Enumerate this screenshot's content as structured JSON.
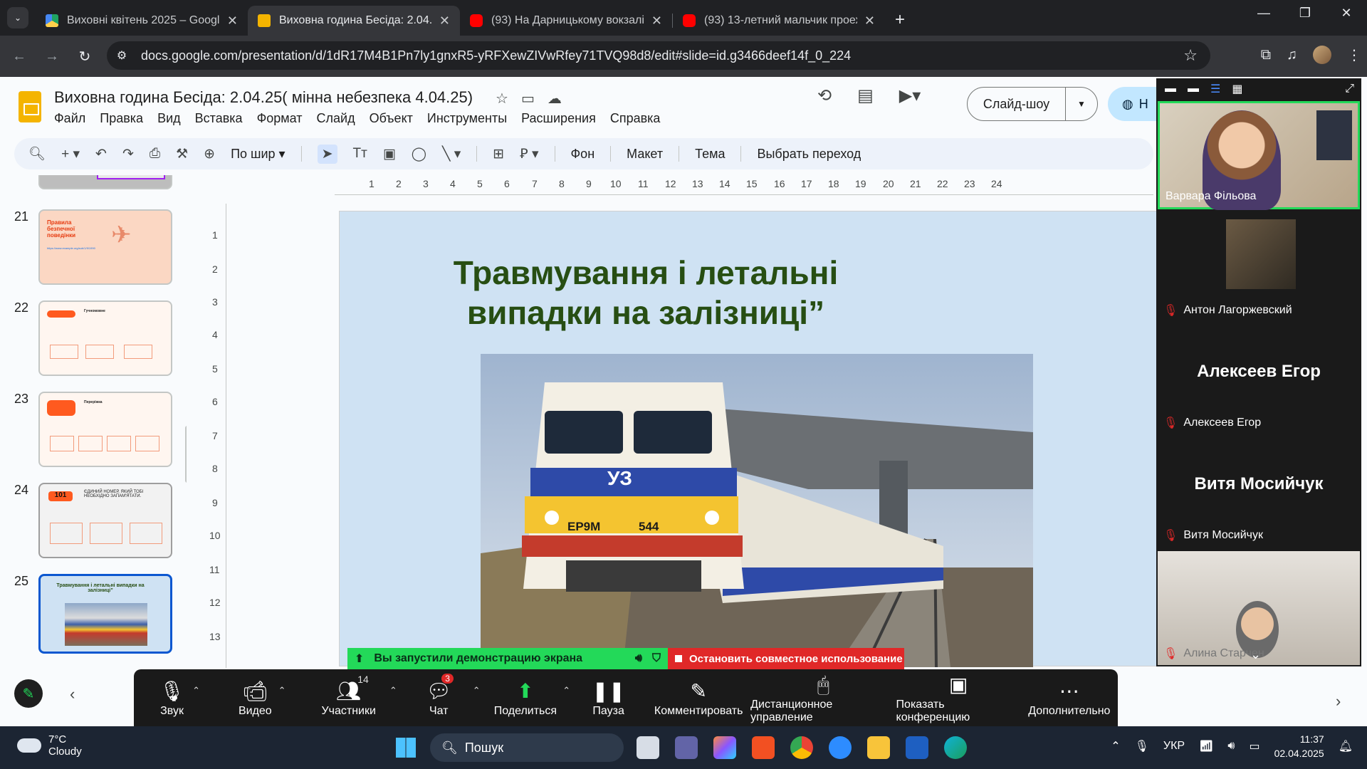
{
  "browser": {
    "tabs": [
      {
        "title": "Виховні квітень 2025 – Google",
        "favicon": "google-drive-icon",
        "active": false
      },
      {
        "title": "Виховна година Бесіда: 2.04.25",
        "favicon": "google-slides-icon",
        "active": true
      },
      {
        "title": "(93) На Дарницькому вокзалі",
        "favicon": "youtube-icon",
        "active": false
      },
      {
        "title": "(93) 13-летний мальчик проех",
        "favicon": "youtube-icon",
        "active": false
      }
    ],
    "url": "docs.google.com/presentation/d/1dR17M4B1Pn7ly1gnxR5-yRFXewZIVwRfey71TVQ98d8/edit#slide=id.g3466deef14f_0_224"
  },
  "slides": {
    "doc_title": "Виховна година Бесіда: 2.04.25( мінна небезпека 4.04.25)",
    "menu": [
      "Файл",
      "Правка",
      "Вид",
      "Вставка",
      "Формат",
      "Слайд",
      "Объект",
      "Инструменты",
      "Расширения",
      "Справка"
    ],
    "slideshow_label": "Слайд-шоу",
    "share_label": "Н",
    "toolbar": {
      "zoom_label": "По шир",
      "background": "Фон",
      "layout": "Макет",
      "theme": "Тема",
      "transition": "Выбрать переход"
    },
    "filmstrip": [
      {
        "num": "21",
        "title": "Правила безпечної поведінки",
        "link": "https://www.example.org/sub/1/9/1990"
      },
      {
        "num": "22",
        "title": "Гучномовне"
      },
      {
        "num": "23",
        "title": "Переріжка"
      },
      {
        "num": "24",
        "title": "ЄДИНИЙ НОМЕР, ЯКИЙ ТОБІ НЕОБХІДНО ЗАПАМ'ЯТАТИ.",
        "badge": "101"
      },
      {
        "num": "25",
        "title": "Травмування і летальні випадки на залізниці”"
      }
    ],
    "ruler_h": [
      "1",
      "2",
      "3",
      "4",
      "5",
      "6",
      "7",
      "8",
      "9",
      "10",
      "11",
      "12",
      "13",
      "14",
      "15",
      "16",
      "17",
      "18",
      "19",
      "20",
      "21",
      "22",
      "23",
      "24"
    ],
    "ruler_v": [
      "1",
      "2",
      "3",
      "4",
      "5",
      "6",
      "7",
      "8",
      "9",
      "10",
      "11",
      "12",
      "13"
    ],
    "current_slide": {
      "title": "Травмування і летальні випадки на залізниці”",
      "train_logo": "УЗ",
      "train_model": "ЕР9М",
      "train_number": "544"
    }
  },
  "zoom": {
    "share_notice": "Вы запустили демонстрацию экрана",
    "stop_share": "Остановить совместное использование",
    "toolbar": [
      {
        "label": "Звук",
        "icon": "microphone-icon"
      },
      {
        "label": "Видео",
        "icon": "video-camera-icon"
      },
      {
        "label": "Участники",
        "icon": "participants-icon",
        "count": "14"
      },
      {
        "label": "Чат",
        "icon": "chat-icon",
        "badge": "3"
      },
      {
        "label": "Поделиться",
        "icon": "share-screen-icon"
      },
      {
        "label": "Пауза",
        "icon": "pause-icon"
      },
      {
        "label": "Комментировать",
        "icon": "annotate-pencil-icon"
      },
      {
        "label": "Дистанционное управление",
        "icon": "mouse-icon"
      },
      {
        "label": "Показать конференцию",
        "icon": "show-meeting-icon"
      },
      {
        "label": "Дополнительно",
        "icon": "more-icon"
      }
    ],
    "participants": [
      {
        "name": "Варвара Фільова",
        "video": true,
        "muted": false
      },
      {
        "name": "Антон Лагоржевский",
        "video": "avatar",
        "muted": true
      },
      {
        "name": "Алексеев Егор",
        "display": "Алексеев Егор",
        "muted": true
      },
      {
        "name": "Витя Мосийчук",
        "display": "Витя Мосийчук",
        "muted": true
      },
      {
        "name": "Алина Старчен",
        "video": true,
        "muted": true
      }
    ]
  },
  "taskbar": {
    "temperature": "7°C",
    "condition": "Cloudy",
    "search": "Пошук",
    "language": "УКР",
    "time": "11:37",
    "date": "02.04.2025"
  },
  "colors": {
    "slide_bg": "#cfe2f3",
    "slide_title": "#274e13",
    "zoom_green": "#23d959",
    "zoom_red": "#e02828",
    "accent_blue": "#0b57d0"
  }
}
